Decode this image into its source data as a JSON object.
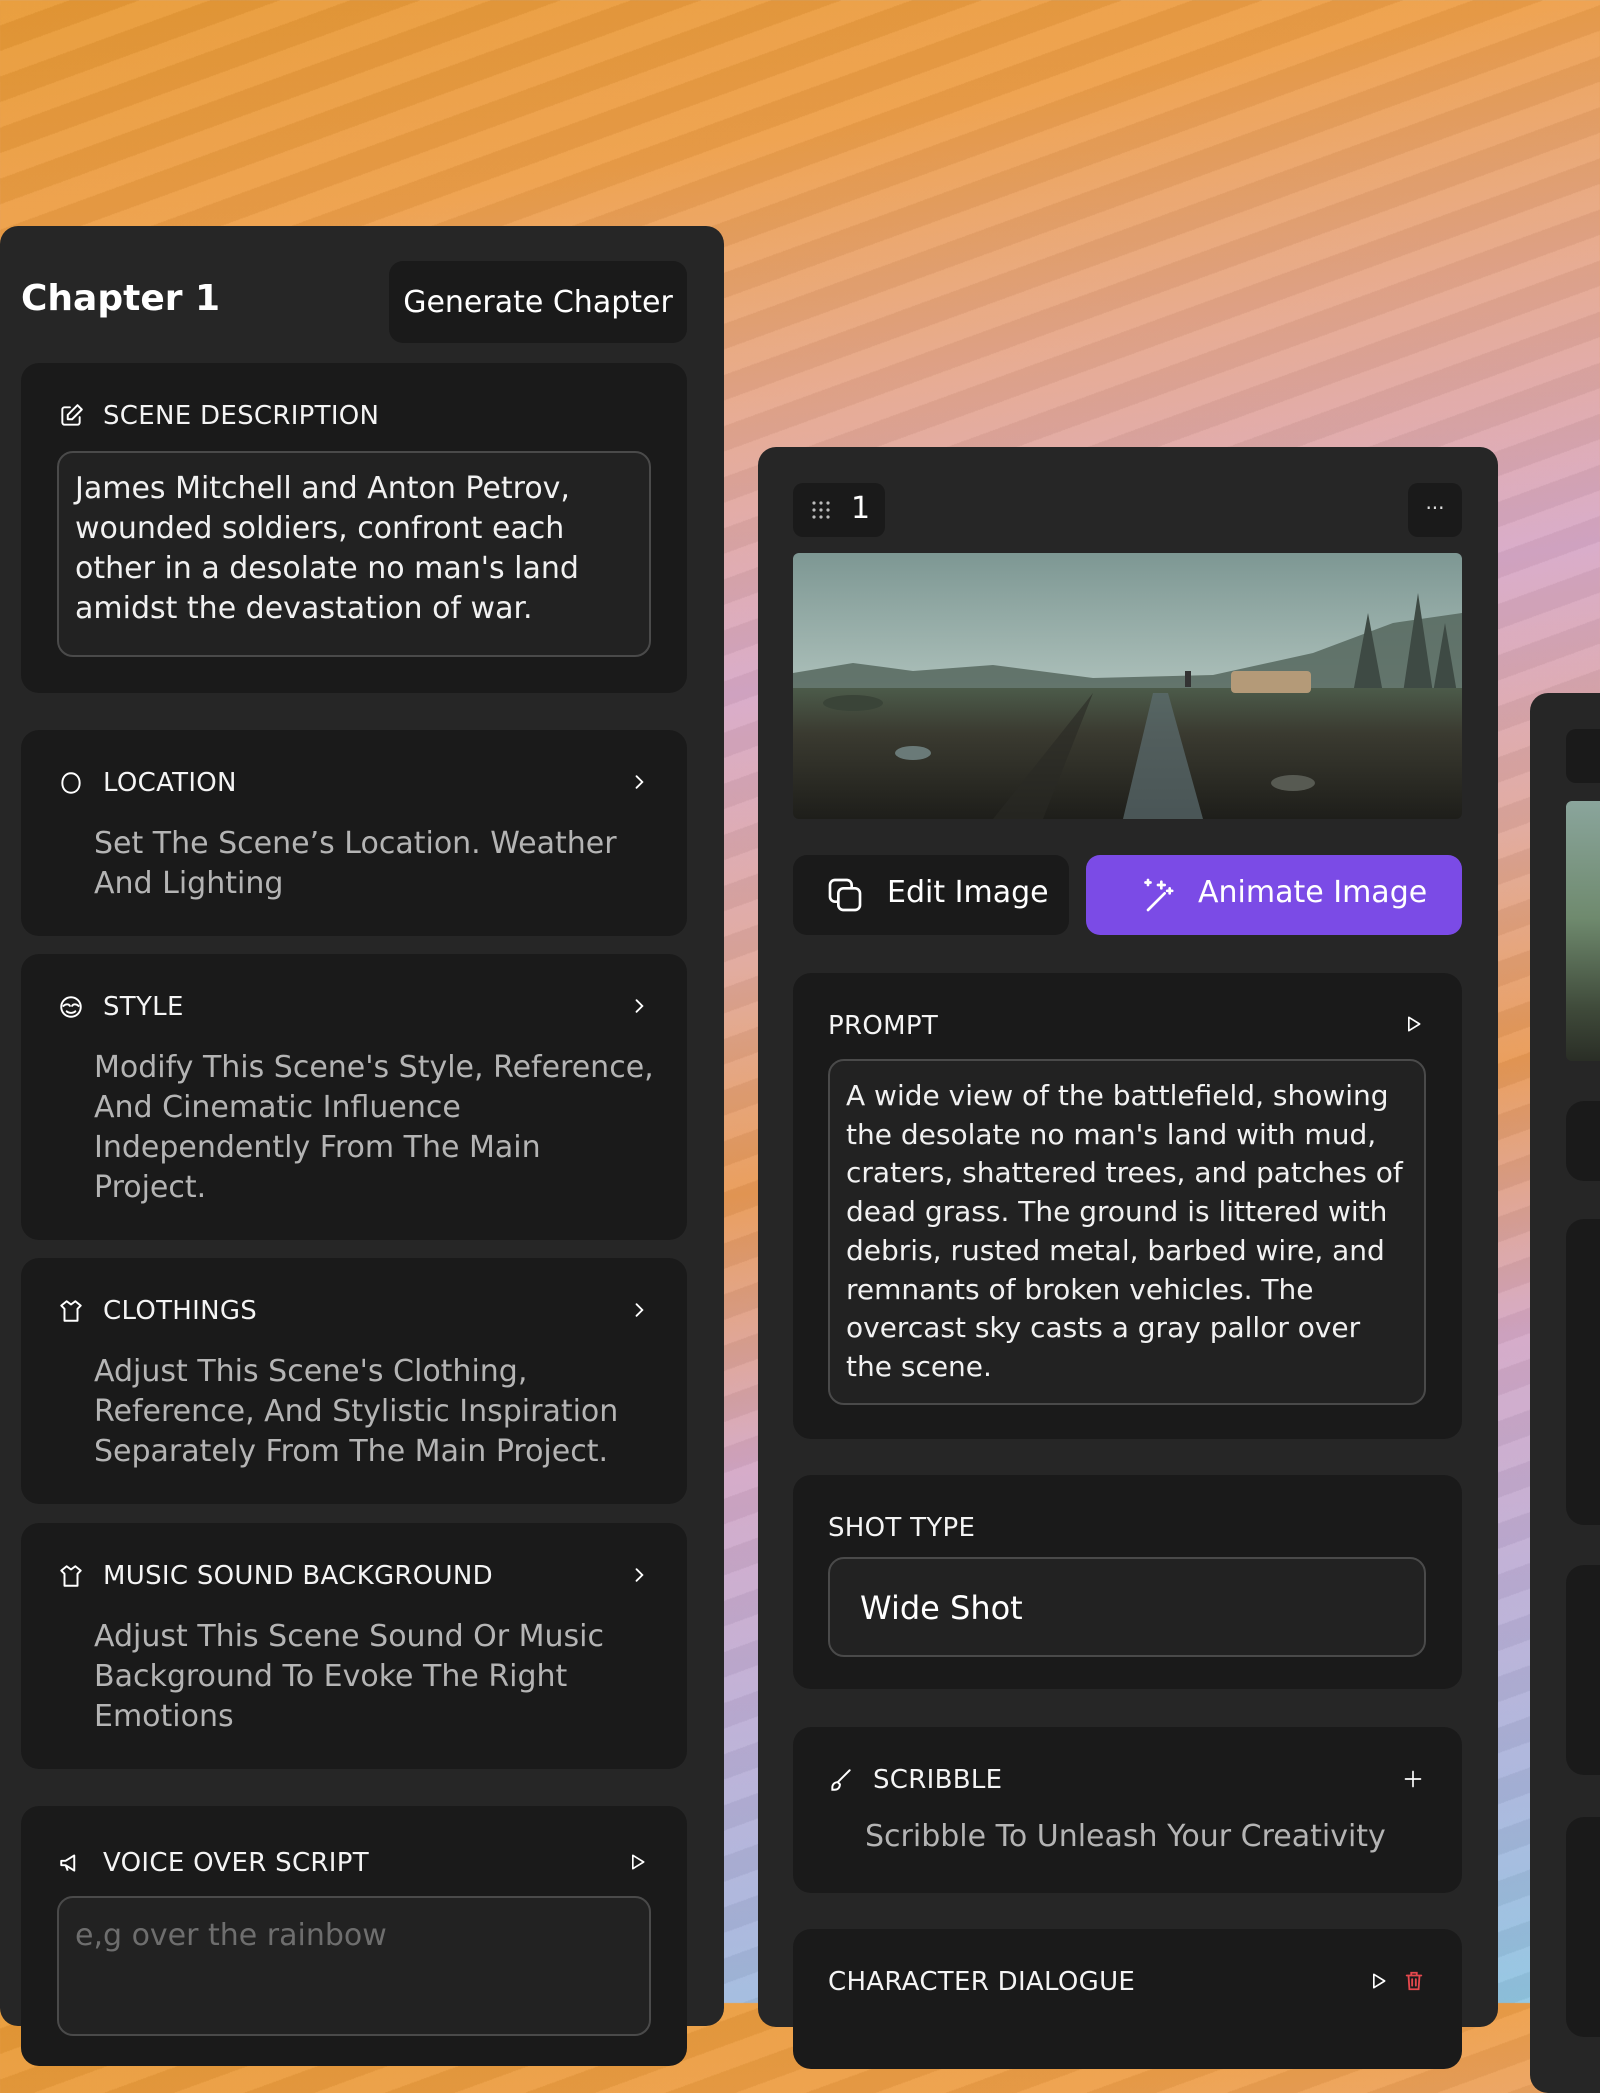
{
  "chapter": {
    "title": "Chapter 1",
    "generate_label": "Generate Chapter"
  },
  "scene_description": {
    "label": "SCENE DESCRIPTION",
    "text": "James Mitchell and Anton Petrov, wounded soldiers, confront each other in a desolate no man's land amidst the devastation of war."
  },
  "location": {
    "label": "LOCATION",
    "desc": "Set The Scene’s Location. Weather And Lighting"
  },
  "style": {
    "label": "STYLE",
    "desc": "Modify This Scene's Style, Reference, And Cinematic Influence Independently From The Main Project."
  },
  "clothings": {
    "label": "CLOTHINGS",
    "desc": "Adjust This Scene's Clothing, Reference, And Stylistic Inspiration Separately From The Main Project."
  },
  "music": {
    "label": "MUSIC SOUND BACKGROUND",
    "desc": "Adjust This Scene Sound Or Music Background To Evoke The Right Emotions"
  },
  "voice_over": {
    "label": "VOICE OVER SCRIPT",
    "placeholder": "e,g over the rainbow"
  },
  "shot": {
    "number": "1",
    "more_label": "···",
    "edit_label": "Edit Image",
    "animate_label": "Animate Image",
    "prompt_label": "PROMPT",
    "prompt_text": "A wide view of the battlefield, showing the desolate no man's land with mud, craters, shattered trees, and patches of dead grass. The ground is littered with debris, rusted metal, barbed wire, and remnants of broken vehicles. The overcast sky casts a gray pallor over the scene.",
    "shot_type_label": "SHOT TYPE",
    "shot_type_value": "Wide Shot",
    "scribble_label": "SCRIBBLE",
    "scribble_desc": "Scribble To Unleash Your Creativity",
    "dialogue_label": "CHARACTER DIALOGUE"
  },
  "colors": {
    "accent": "#7b4be6",
    "panel": "#262626",
    "card": "#1a1a1a",
    "delete": "#e5484d"
  }
}
